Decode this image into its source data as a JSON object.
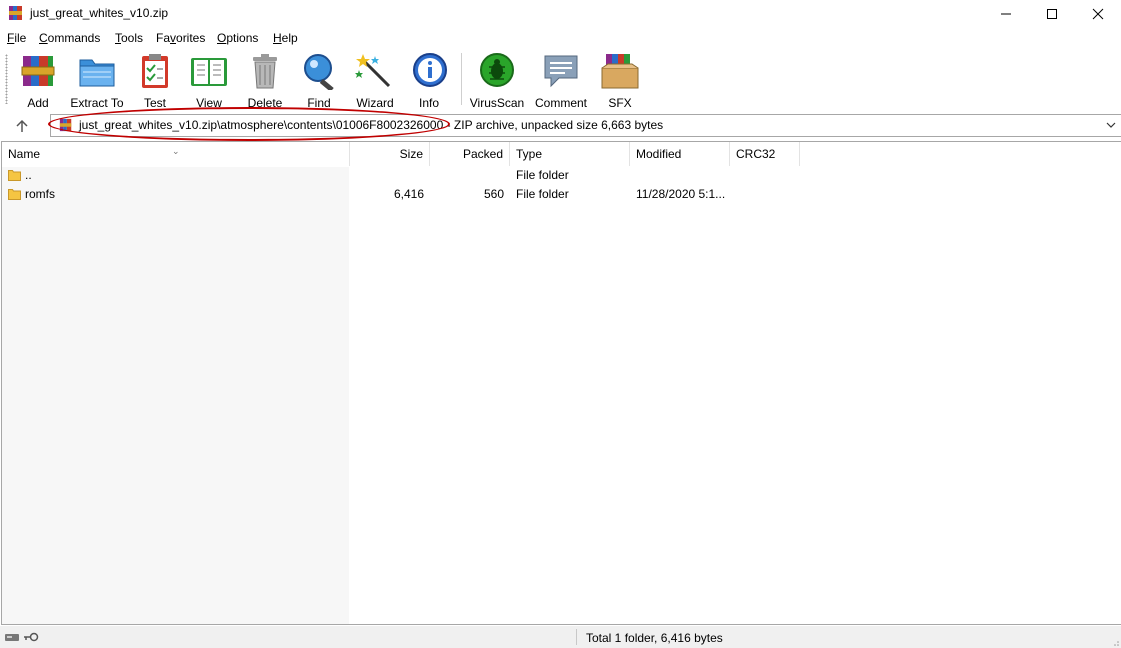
{
  "window": {
    "title": "just_great_whites_v10.zip"
  },
  "menu": [
    {
      "key": "F",
      "rest": "ile"
    },
    {
      "key": "C",
      "rest": "ommands"
    },
    {
      "key": "T",
      "rest": "ools"
    },
    {
      "key": "F",
      "rest": "avorites",
      "pre": "Fa",
      "keyalt": "v"
    },
    {
      "key": "O",
      "rest": "ptions"
    },
    {
      "key": "H",
      "rest": "elp"
    }
  ],
  "menu_labels": [
    "File",
    "Commands",
    "Tools",
    "Favorites",
    "Options",
    "Help"
  ],
  "toolbar": {
    "add": "Add",
    "extract": "Extract To",
    "test": "Test",
    "view": "View",
    "delete": "Delete",
    "find": "Find",
    "wizard": "Wizard",
    "info": "Info",
    "virusscan": "VirusScan",
    "comment": "Comment",
    "sfx": "SFX"
  },
  "address": {
    "path": "just_great_whites_v10.zip\\atmosphere\\contents\\01006F8002326000 - ZIP archive, unpacked size 6,663 bytes"
  },
  "columns": {
    "name": "Name",
    "size": "Size",
    "packed": "Packed",
    "type": "Type",
    "modified": "Modified",
    "crc": "CRC32"
  },
  "rows": [
    {
      "name": "..",
      "size": "",
      "packed": "",
      "type": "File folder",
      "modified": "",
      "crc": ""
    },
    {
      "name": "romfs",
      "size": "6,416",
      "packed": "560",
      "type": "File folder",
      "modified": "11/28/2020 5:1...",
      "crc": ""
    }
  ],
  "status": {
    "text": "Total 1 folder, 6,416 bytes"
  },
  "colors": {
    "annotation": "#c00000",
    "folder": "#f5c542"
  }
}
